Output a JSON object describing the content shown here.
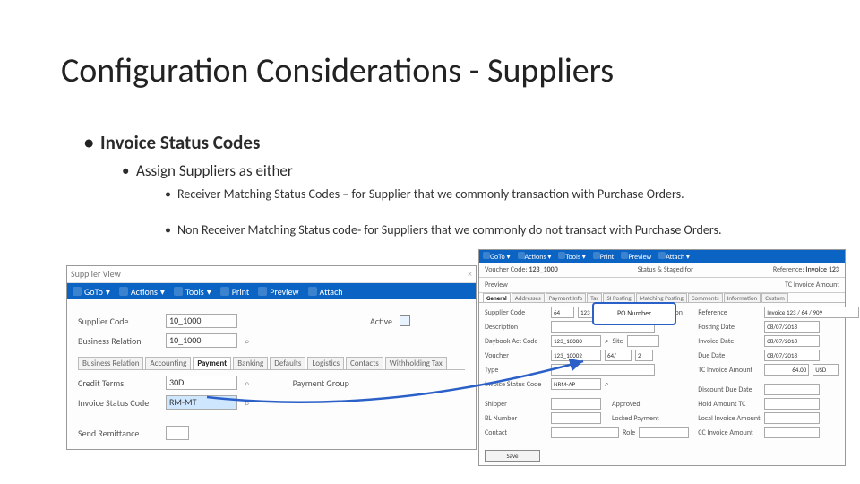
{
  "title": "Configuration Considerations - Suppliers",
  "bullets": {
    "lvl1": "Invoice Status Codes",
    "lvl2": "Assign Suppliers as either",
    "lvl3a": "Receiver Matching Status Codes – for Supplier that we commonly transaction with Purchase Orders.",
    "lvl3b": "Non Receiver Matching Status code- for Suppliers that we commonly do not transact with Purchase Orders."
  },
  "supplier_view": {
    "tab_label": "Supplier View",
    "close": "×",
    "ribbon": {
      "goto": "GoTo",
      "actions": "Actions",
      "tools": "Tools",
      "print": "Print",
      "preview": "Preview",
      "attach": "Attach"
    },
    "fields": {
      "supplier_code_label": "Supplier Code",
      "supplier_code": "10_1000",
      "active_label": "Active",
      "business_relation_label": "Business Relation",
      "business_relation": "10_1000"
    },
    "tabs": [
      "Business Relation",
      "Accounting",
      "Payment",
      "Banking",
      "Defaults",
      "Logistics",
      "Contacts",
      "Withholding Tax"
    ],
    "active_tab": "Payment",
    "payment": {
      "credit_terms_label": "Credit Terms",
      "credit_terms": "30D",
      "invoice_status_label": "Invoice Status Code",
      "invoice_status": "RM-MT",
      "payment_group_label": "Payment Group",
      "send_remittance_label": "Send Remittance"
    }
  },
  "invoice_view": {
    "ribbon": {
      "goto": "GoTo",
      "actions": "Actions",
      "tools": "Tools",
      "print": "Print",
      "preview": "Preview",
      "attach": "Attach"
    },
    "header": {
      "voucher_label": "Voucher Code",
      "voucher": "123_1000",
      "status_label": "Status & Staged for",
      "status": "",
      "reference_label": "Reference",
      "reference": "Invoice 123",
      "preview_label": "Preview",
      "tc_label": "TC Invoice Amount"
    },
    "tabs": [
      "General",
      "Addresses",
      "Payment Info",
      "Tax",
      "SI Posting",
      "Matching Posting",
      "Comments",
      "Information",
      "Custom"
    ],
    "active_tab": "General",
    "callout": "PO Number",
    "fields": {
      "supplier_code_label": "Supplier Code",
      "supplier_code": "64",
      "supplier_code2": "123_64",
      "br": "Business Relation",
      "reference_label": "Reference",
      "reference": "Invoice 123 / 64 / 909",
      "description_label": "Description",
      "posting_date_label": "Posting Date",
      "posting_date": "08/07/2018",
      "invoice_date_label": "Invoice Date",
      "invoice_date": "08/07/2018",
      "daybook_code_label": "Daybook Act Code",
      "daybook_code": "123_10000",
      "site": "Site",
      "voucher_label": "Voucher",
      "voucher": "123_10002",
      "v2": "64/",
      "v3": "2",
      "type_label": "Type",
      "invoice_status_label": "Invoice Status Code",
      "invoice_status": "NRM-AP",
      "due_date_label": "Due Date",
      "due_date": "08/07/2018",
      "tc_amount_label": "TC Invoice Amount",
      "tc_amount": "64.00",
      "cur": "USD",
      "shipper_label": "Shipper",
      "approved_label": "Approved",
      "locked_label": "Locked Payment",
      "discount_label": "Discount Due Date",
      "hold_label": "Hold Amount TC",
      "bl_label": "BL Number",
      "local_label": "Local Invoice Amount",
      "cc_label": "CC Invoice Amount",
      "contact_label": "Contact",
      "role_label": "Role"
    },
    "save_label": "Save"
  }
}
